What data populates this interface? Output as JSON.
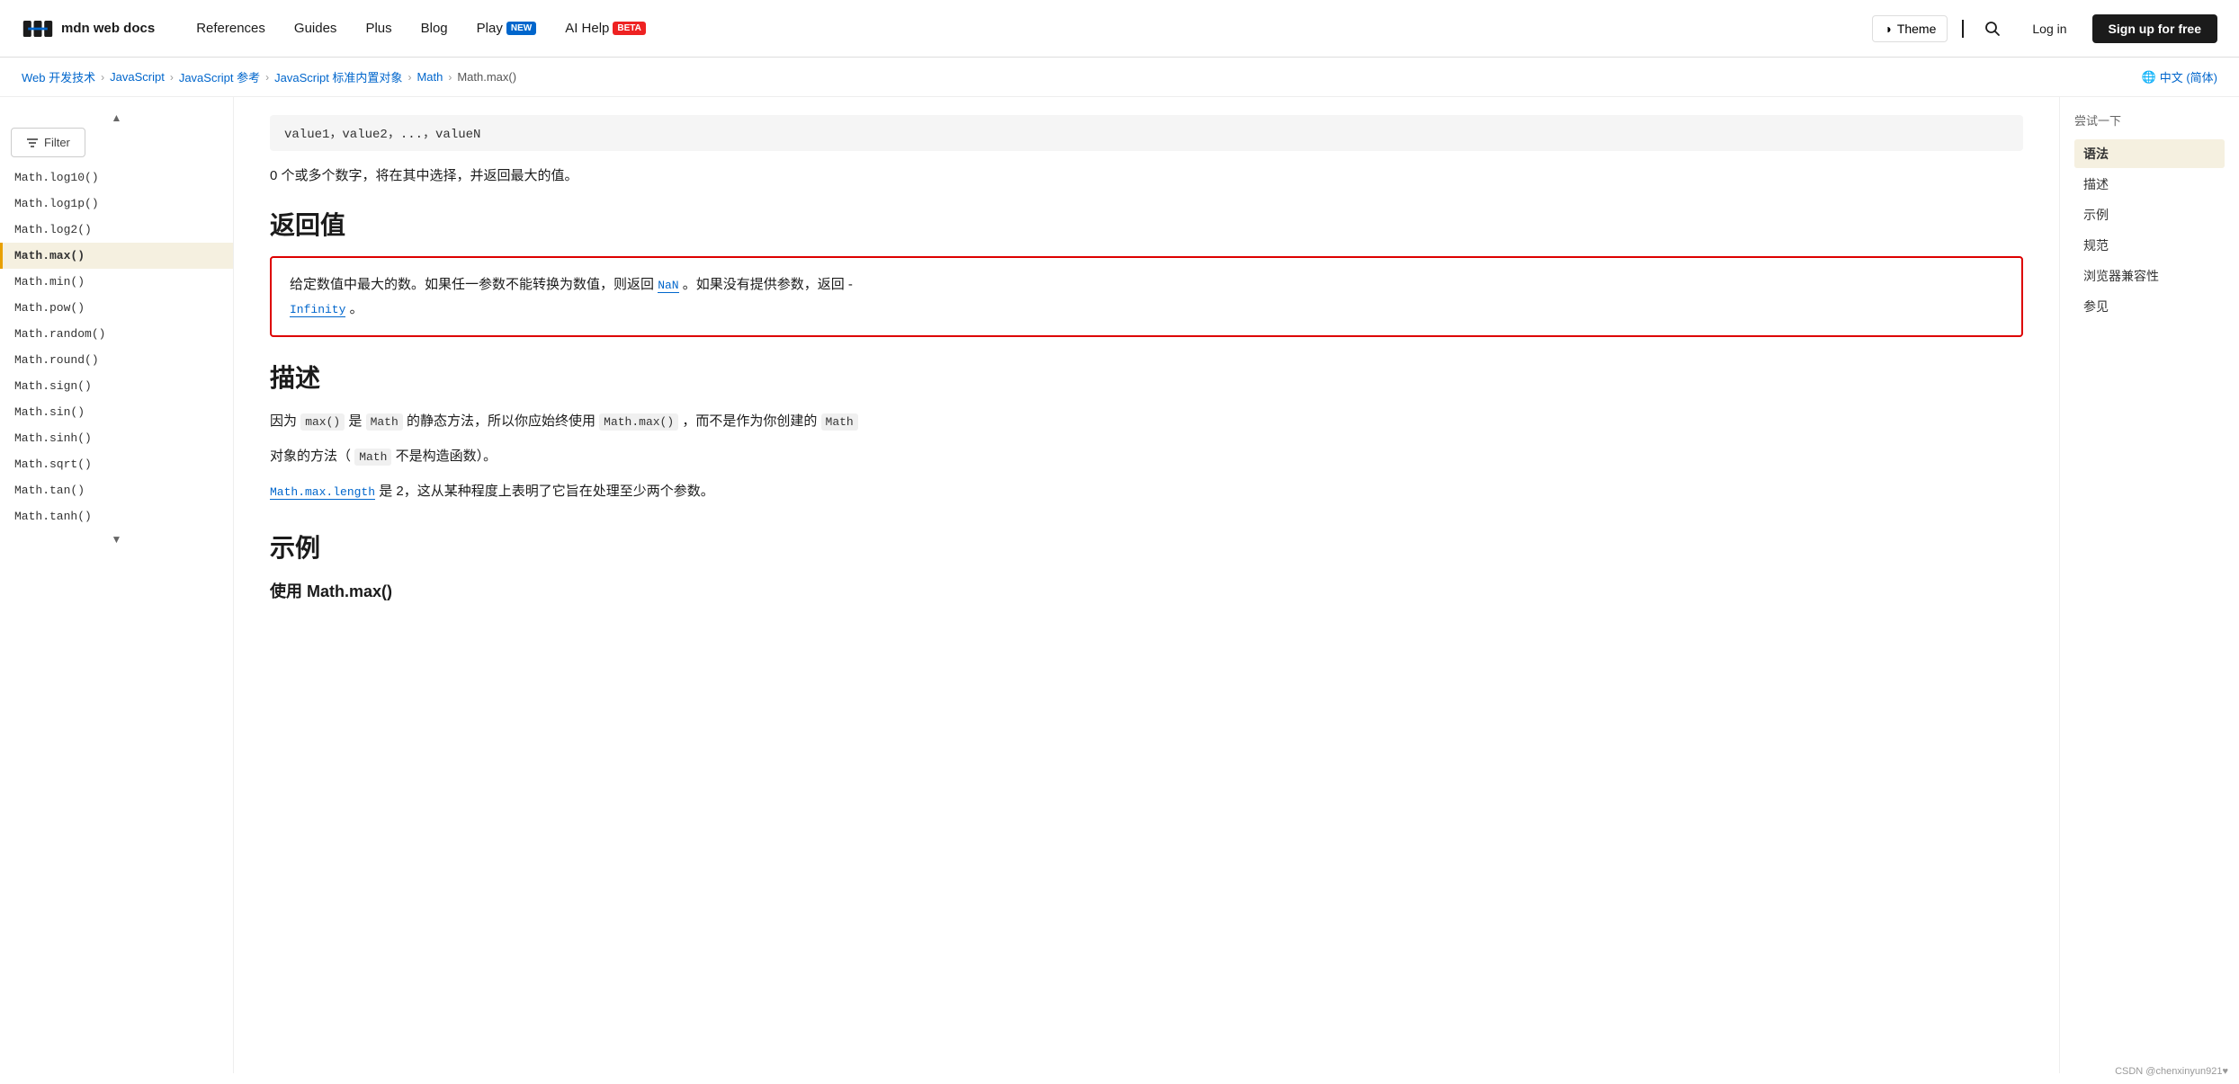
{
  "header": {
    "logo_text": "mdn web docs",
    "nav": [
      {
        "label": "References",
        "badge": null
      },
      {
        "label": "Guides",
        "badge": null
      },
      {
        "label": "Plus",
        "badge": null
      },
      {
        "label": "Blog",
        "badge": null
      },
      {
        "label": "Play",
        "badge": "NEW"
      },
      {
        "label": "AI Help",
        "badge": "BETA"
      }
    ],
    "theme_label": "Theme",
    "login_label": "Log in",
    "signup_label": "Sign up for free"
  },
  "breadcrumb": {
    "items": [
      "Web 开发技术",
      "JavaScript",
      "JavaScript 参考",
      "JavaScript 标准内置对象",
      "Math",
      "Math.max()"
    ],
    "lang": "中文 (简体)"
  },
  "sidebar": {
    "filter_label": "Filter",
    "items": [
      "Math.log10()",
      "Math.log1p()",
      "Math.log2()",
      "Math.max()",
      "Math.min()",
      "Math.pow()",
      "Math.random()",
      "Math.round()",
      "Math.sign()",
      "Math.sin()",
      "Math.sinh()",
      "Math.sqrt()",
      "Math.tan()",
      "Math.tanh()"
    ],
    "active": "Math.max()"
  },
  "main": {
    "params": "value1，value2，...，valueN",
    "param_desc": "0 个或多个数字，将在其中选择，并返回最大的值。",
    "section_return": "返回值",
    "return_box": {
      "text_before": "给定数值中最大的数。如果任一参数不能转换为数值，则返回",
      "nan_link": "NaN",
      "text_middle": "。如果没有提供参数，返回 -",
      "infinity_link": "Infinity",
      "text_after": "。"
    },
    "section_desc": "描述",
    "desc_p1_before": "因为",
    "desc_code1": "max()",
    "desc_p1_mid1": "是",
    "desc_code2": "Math",
    "desc_p1_mid2": "的静态方法，所以你应始终使用",
    "desc_code3": "Math.max()",
    "desc_p1_mid3": "，而不是作为你创建的",
    "desc_code4": "Math",
    "desc_p1_end": "对象的方法（",
    "desc_code5": "Math",
    "desc_p1_end2": "不是构造函数）。",
    "desc_p2_link": "Math.max.length",
    "desc_p2_rest": "是 2，这从某种程度上表明了它旨在处理至少两个参数。",
    "section_example": "示例",
    "example_title": "使用 Math.max()"
  },
  "toc": {
    "title": "尝试一下",
    "items": [
      {
        "label": "语法",
        "active": true
      },
      {
        "label": "描述",
        "active": false
      },
      {
        "label": "示例",
        "active": false
      },
      {
        "label": "规范",
        "active": false
      },
      {
        "label": "浏览器兼容性",
        "active": false
      },
      {
        "label": "参见",
        "active": false
      }
    ]
  },
  "watermark": "CSDN @chenxinyun921♥"
}
